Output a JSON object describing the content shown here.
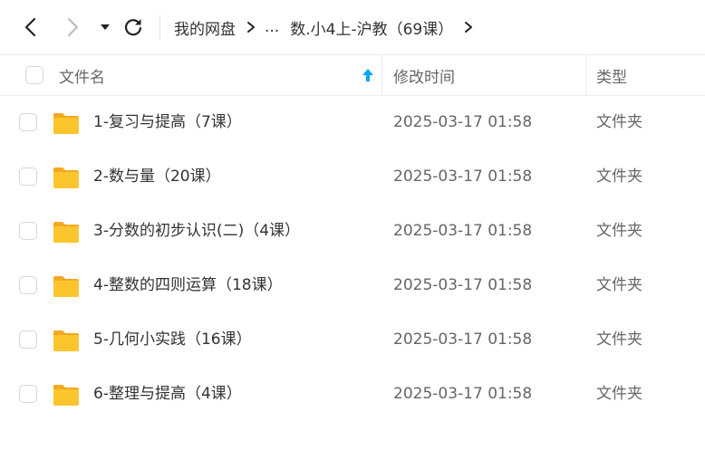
{
  "toolbar": {
    "back_icon": "chevron-left-icon",
    "forward_icon": "chevron-right-icon",
    "history_icon": "caret-down-icon",
    "refresh_icon": "refresh-icon"
  },
  "breadcrumb": {
    "root": "我的网盘",
    "ellipsis": "...",
    "current": "数.小4上-沪教（69课）"
  },
  "header": {
    "name": "文件名",
    "modified": "修改时间",
    "type": "类型",
    "sort_icon": "sort-up-arrow-icon",
    "sort_color": "#06a7ff"
  },
  "colors": {
    "folder": "#fcc52e",
    "folder_back": "#f3a920",
    "accent": "#06a7ff"
  },
  "rows": [
    {
      "name": "1-复习与提高（7课）",
      "modified": "2025-03-17 01:58",
      "type": "文件夹"
    },
    {
      "name": "2-数与量（20课）",
      "modified": "2025-03-17 01:58",
      "type": "文件夹"
    },
    {
      "name": "3-分数的初步认识(二)（4课）",
      "modified": "2025-03-17 01:58",
      "type": "文件夹"
    },
    {
      "name": "4-整数的四则运算（18课）",
      "modified": "2025-03-17 01:58",
      "type": "文件夹"
    },
    {
      "name": "5-几何小实践（16课）",
      "modified": "2025-03-17 01:58",
      "type": "文件夹"
    },
    {
      "name": "6-整理与提高（4课）",
      "modified": "2025-03-17 01:58",
      "type": "文件夹"
    }
  ]
}
